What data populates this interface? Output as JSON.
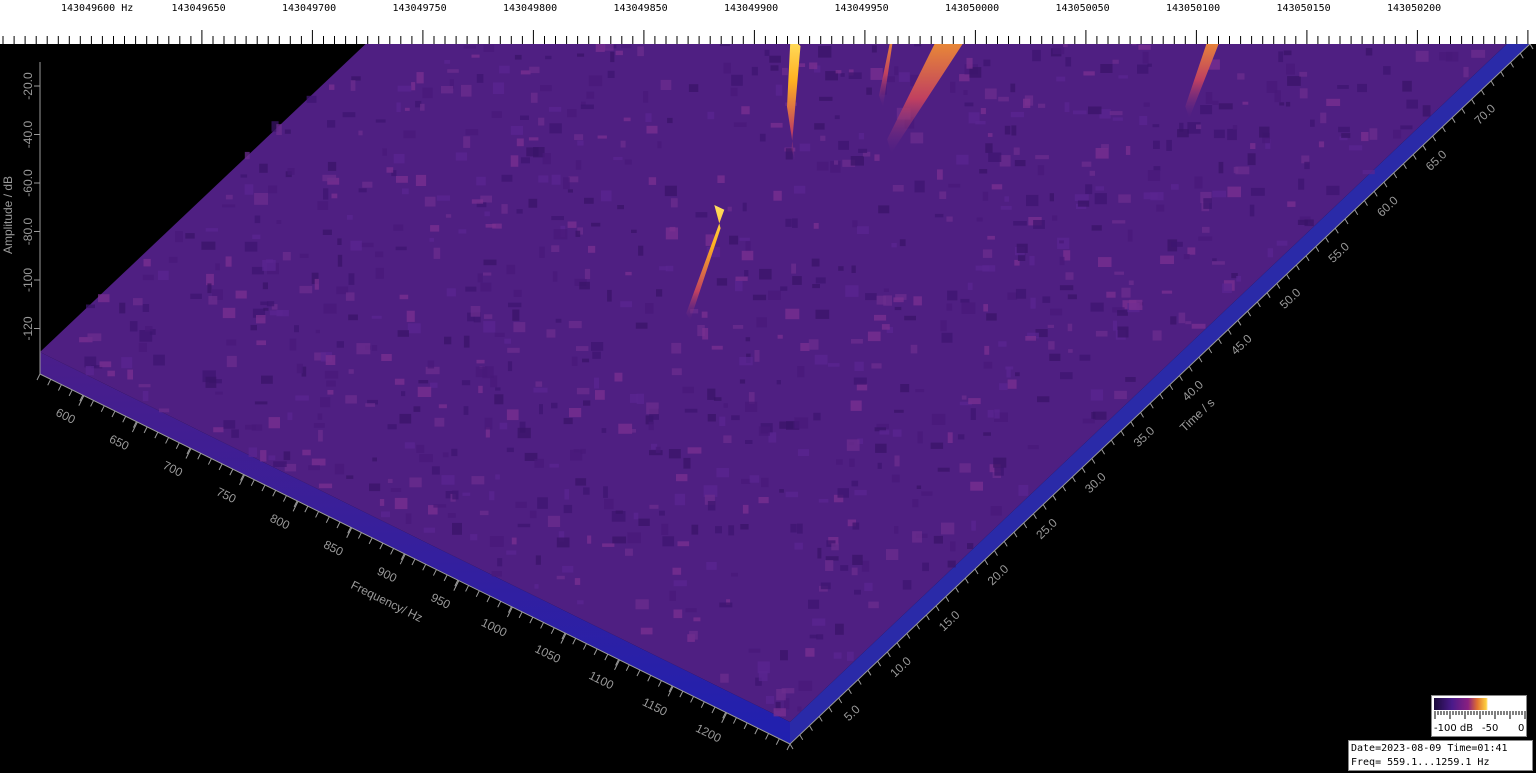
{
  "chart_data": {
    "type": "heatmap",
    "title": "",
    "top_axis": {
      "unit": "Hz",
      "labels": [
        "143049600",
        "143049650",
        "143049700",
        "143049750",
        "143049800",
        "143049850",
        "143049900",
        "143049950",
        "143050000",
        "143050050",
        "143050100",
        "143050150",
        "143050200"
      ]
    },
    "amplitude_axis": {
      "label": "Amplitude / dB",
      "ticks": [
        "-20.0",
        "-40.0",
        "-60.0",
        "-80.0",
        "-100",
        "-120"
      ]
    },
    "frequency_axis": {
      "label": "Frequency/ Hz",
      "ticks": [
        "600",
        "650",
        "700",
        "750",
        "800",
        "850",
        "900",
        "950",
        "1000",
        "1050",
        "1100",
        "1150",
        "1200"
      ],
      "range": [
        559.1,
        1259.1
      ]
    },
    "time_axis": {
      "label": "Time / s",
      "ticks": [
        "5.0",
        "10.0",
        "15.0",
        "20.0",
        "25.0",
        "30.0",
        "35.0",
        "40.0",
        "45.0",
        "50.0",
        "55.0",
        "60.0",
        "65.0",
        "70.0"
      ]
    },
    "peaks": [
      {
        "freq_hz": 862,
        "time_s_start": 40,
        "time_s_end": 44,
        "level_db": -40
      },
      {
        "freq_hz": 880,
        "time_s_start": 47,
        "time_s_end": 53,
        "level_db": -45
      },
      {
        "freq_hz": 915,
        "time_s_start": 44,
        "time_s_end": 60,
        "level_db": -30
      },
      {
        "freq_hz": 993,
        "time_s_start": 64,
        "time_s_end": 72,
        "level_db": -30
      },
      {
        "freq_hz": 1025,
        "time_s_start": 62,
        "time_s_end": 72,
        "level_db": -30
      },
      {
        "freq_hz": 1075,
        "time_s_start": 57,
        "time_s_end": 66,
        "level_db": -45
      },
      {
        "freq_hz": 1005,
        "time_s_start": 74,
        "time_s_end": 78,
        "level_db": -55
      },
      {
        "freq_hz": 900,
        "time_s_start": 25,
        "time_s_end": 33,
        "level_db": -75
      }
    ],
    "noise_floor_db": -120,
    "colors": {
      "low": "#1a0a3a",
      "mid": "#6a2a9a",
      "high": "#ffd040",
      "floor": "#2a1a9a"
    }
  },
  "legend": {
    "min_label": "-100 dB",
    "mid_label": "-50",
    "max_label": "0"
  },
  "info": {
    "line1": "Date=2023-08-09 Time=01:41",
    "line2": "Freq= 559.1...1259.1 Hz"
  }
}
